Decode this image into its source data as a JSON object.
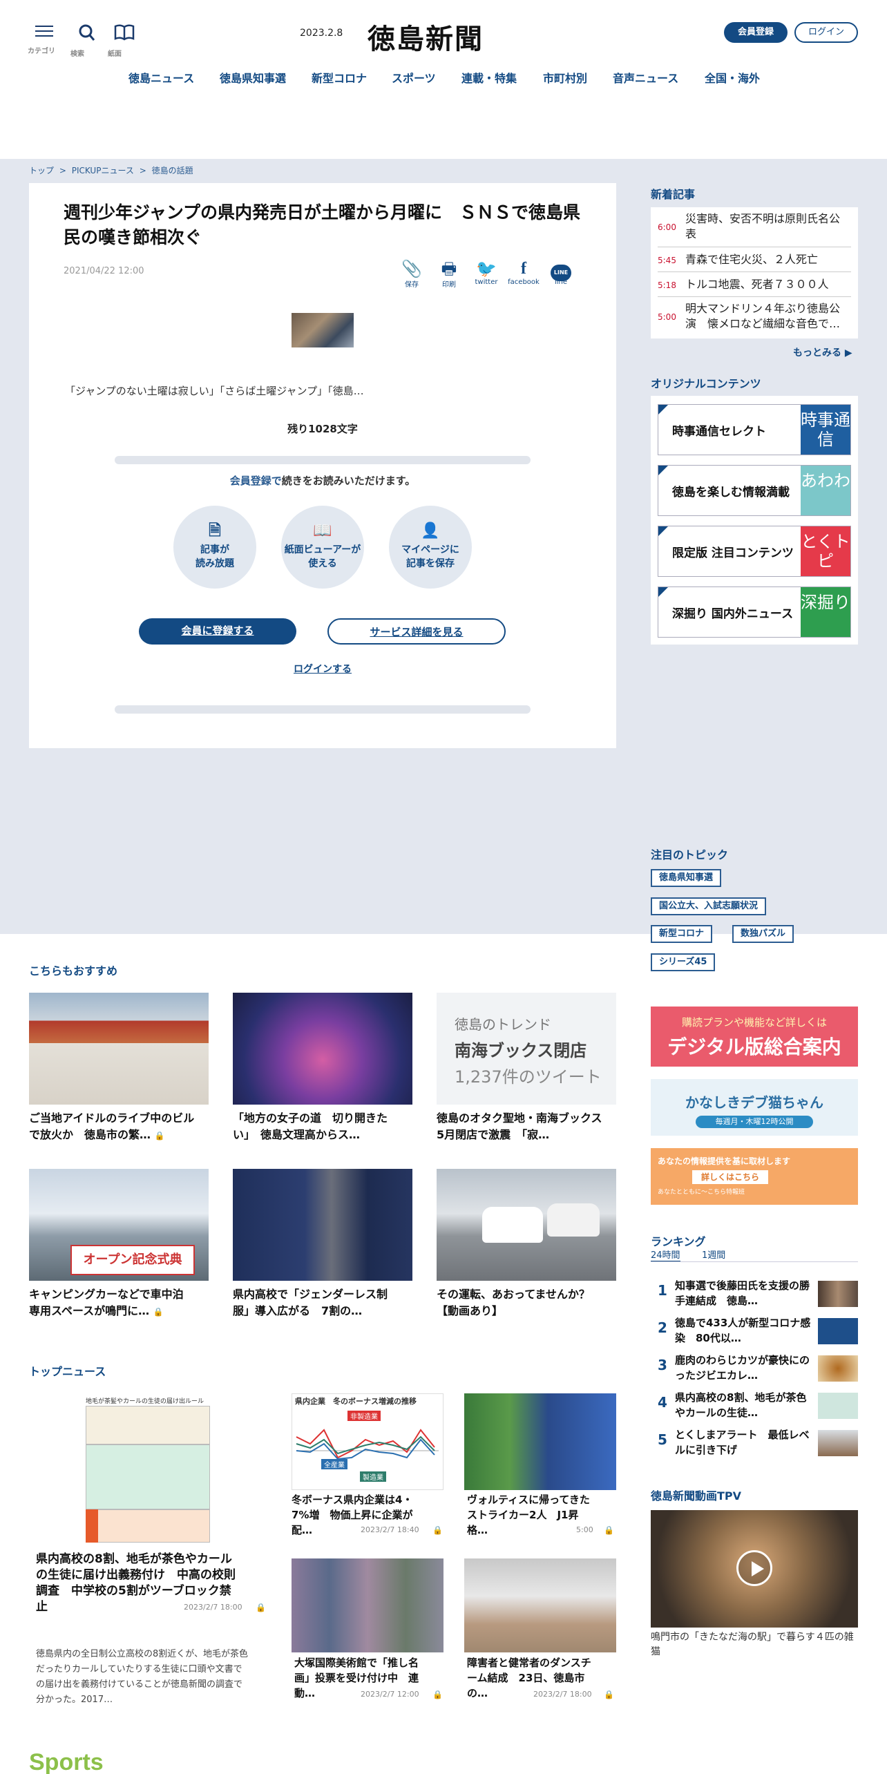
{
  "header": {
    "menu_label": "カテゴリ",
    "search_label": "検索",
    "paper_label": "紙面",
    "date": "2023.2.8",
    "logo": "徳島新聞",
    "register": "会員登録",
    "login": "ログイン"
  },
  "nav": [
    "徳島ニュース",
    "徳島県知事選",
    "新型コロナ",
    "スポーツ",
    "連載・特集",
    "市町村別",
    "音声ニュース",
    "全国・海外"
  ],
  "breadcrumb": [
    "トップ",
    ">",
    "PICKUPニュース",
    ">",
    "徳島の話題"
  ],
  "article": {
    "title": "週刊少年ジャンプの県内発売日が土曜から月曜に　ＳＮＳで徳島県民の嘆き節相次ぐ",
    "date": "2021/04/22 12:00",
    "share": [
      "保存",
      "印刷",
      "twitter",
      "facebook",
      "line"
    ],
    "lead": "「ジャンプのない土曜は寂しい」「さらば土曜ジャンプ」「徳島…",
    "remaining": "残り1028文字",
    "continue_hl": "会員登録で",
    "continue_rest": "続きをお読みいただけます。",
    "features": [
      {
        "l1": "記事が",
        "l2": "読み放題"
      },
      {
        "l1": "紙面ビューアーが",
        "l2": "使える"
      },
      {
        "l1": "マイページに",
        "l2": "記事を保存"
      }
    ],
    "register_btn_a": "会員",
    "register_btn_b": "に登録する",
    "service_btn": "サービス詳細を見る",
    "login_link": "ログインする"
  },
  "sidebar": {
    "new_heading": "新着記事",
    "new": [
      {
        "time": "6:00",
        "title": "災害時、安否不明は原則氏名公表"
      },
      {
        "time": "5:45",
        "title": "青森で住宅火災、２人死亡"
      },
      {
        "time": "5:18",
        "title": "トルコ地震、死者７３００人"
      },
      {
        "time": "5:00",
        "title": "明大マンドリン４年ぶり徳島公演　懐メロなど繊細な音色で…"
      }
    ],
    "more": "もっとみる",
    "original_heading": "オリジナルコンテンツ",
    "original": [
      {
        "label": "時事通信セレクト",
        "badge": "時事通信",
        "color": "#1f5fa0"
      },
      {
        "label": "徳島を楽しむ情報満載",
        "badge": "あわわ",
        "color": "#7cc7c9"
      },
      {
        "label": "限定版 注目コンテンツ",
        "badge": "とくトピ",
        "color": "#e53a4a"
      },
      {
        "label": "深掘り 国内外ニュース",
        "badge": "深掘り",
        "color": "#2e9e4f"
      }
    ],
    "topics_heading": "注目のトピック",
    "topics": [
      "徳島県知事選",
      "国公立大、入試志願状況",
      "新型コロナ",
      "数独パズル",
      "シリーズ45"
    ],
    "ad1_small": "購読プランや機能など詳しくは",
    "ad1_big": "デジタル版総合案内",
    "ad2": "かなしきデブ猫ちゃん",
    "ad2_sub": "毎週月・木曜12時公開",
    "ad3_a": "あなたの情報提供を基に取材します",
    "ad3_b": "詳しくはこちら",
    "ad3_c": "あなたとともに～こちら特報班",
    "ranking_heading": "ランキング",
    "ranking_tabs": [
      "24時間",
      "1週間"
    ],
    "ranking": [
      {
        "n": "1",
        "t": "知事選で後藤田氏を支援の勝手連結成　徳島…"
      },
      {
        "n": "2",
        "t": "徳島で433人が新型コロナ感染　80代以…"
      },
      {
        "n": "3",
        "t": "鹿肉のわらじカツが豪快にのったジビエカレ…"
      },
      {
        "n": "4",
        "t": "県内高校の8割、地毛が茶色やカールの生徒…"
      },
      {
        "n": "5",
        "t": "とくしまアラート　最低レベルに引き下げ"
      }
    ],
    "tpv_heading": "徳島新聞動画TPV",
    "tpv_caption": "鳴門市の「きたなだ海の駅」で暮らす４匹の雑猫"
  },
  "recommend": {
    "heading": "こちらもおすすめ",
    "trend": {
      "a": "徳島のトレンド",
      "b": "南海ブックス閉店",
      "c": "1,237件のツイート"
    },
    "cards": [
      {
        "l1": "ご当地アイドルのライブ中のビル",
        "l2": "で放火か　徳島市の繁…",
        "lock": true
      },
      {
        "l1": "「地方の女子の道　切り開きた",
        "l2": "い」　徳島文理高からス…",
        "lock": false
      },
      {
        "l1": "徳島のオタク聖地・南海ブックス",
        "l2": "5月閉店で激震　「寂…",
        "lock": false
      },
      {
        "l1": "キャンピングカーなどで車中泊",
        "l2": "専用スペースが鳴門に…",
        "lock": true
      },
      {
        "l1": "県内高校で「ジェンダーレス制",
        "l2": "服」導入広がる　7割の…",
        "lock": false
      },
      {
        "l1": "その運転、あおってませんか？",
        "l2": "【動画あり】",
        "lock": false
      }
    ],
    "sign": "オープン記念式典"
  },
  "top": {
    "heading": "トップニュース",
    "main": {
      "l1": "県内高校の8割、地毛が茶色やカール",
      "l2": "の生徒に届け出義務付け　中高の校則",
      "l3": "調査　中学校の5割がツーブロック禁",
      "l4": "止",
      "date": "2023/2/7 18:00",
      "body1": "徳島県内の全日制公立高校の8割近くが、地毛が茶色",
      "body2": "だったりカールしていたりする生徒に口頭や文書で",
      "body3": "の届け出を義務付けていることが徳島新聞の調査で",
      "body4": "分かった。2017…"
    },
    "table_title": "地毛が茶髪やカールの生徒の届け出ルール",
    "chart_title": "県内企業　冬のボーナス増減の推移",
    "chart_labels": [
      "非製造業",
      "全産業",
      "製造業"
    ],
    "items": [
      {
        "l1": "冬ボーナス県内企業は4・",
        "l2": "7%増　物価上昇に企業が",
        "l3": "配…",
        "date": "2023/2/7 18:40"
      },
      {
        "l1": "ヴォルティスに帰ってきた",
        "l2": "ストライカー2人　J1昇",
        "l3": "格…",
        "date": "5:00"
      },
      {
        "l1": "大塚国際美術館で「推し名",
        "l2": "画」投票を受け付け中　連",
        "l3": "動…",
        "date": "2023/2/7 12:00"
      },
      {
        "l1": "障害者と健常者のダンスチ",
        "l2": "ーム結成　23日、徳島市",
        "l3": "の…",
        "date": "2023/2/7 18:00"
      }
    ]
  },
  "sports_heading": "Sports"
}
